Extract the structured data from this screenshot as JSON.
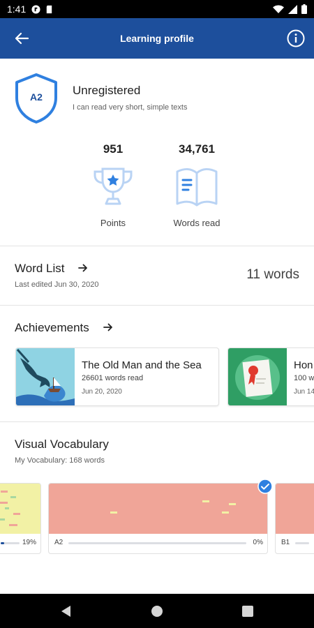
{
  "status_bar": {
    "time": "1:41"
  },
  "app_bar": {
    "title": "Learning profile"
  },
  "level": {
    "badge": "A2",
    "title": "Unregistered",
    "description": "I can read very short, simple texts"
  },
  "stats": [
    {
      "value": "951",
      "label": "Points",
      "icon": "trophy-icon"
    },
    {
      "value": "34,761",
      "label": "Words read",
      "icon": "book-icon"
    }
  ],
  "word_list": {
    "title": "Word List",
    "subtitle": "Last edited Jun 30, 2020",
    "count": "11 words"
  },
  "achievements": {
    "title": "Achievements",
    "cards": [
      {
        "title": "The Old Man and the Sea",
        "subtitle": "26601 words read",
        "date": "Jun 20, 2020",
        "thumb": "marlin-illustration"
      },
      {
        "title": "Hon",
        "subtitle": "100 w",
        "date": "Jun 14",
        "thumb": "certificate-illustration"
      }
    ]
  },
  "visual_vocabulary": {
    "title": "Visual Vocabulary",
    "subtitle": "My Vocabulary: 168 words",
    "cards": [
      {
        "level": "",
        "percent": "19%",
        "progress": 0.19,
        "color": "#f2f1a5"
      },
      {
        "level": "A2",
        "percent": "0%",
        "progress": 0.0,
        "color": "#f0a598",
        "selected": true
      },
      {
        "level": "B1",
        "percent": "",
        "progress": 0.0,
        "color": "#f0a598"
      }
    ]
  },
  "colors": {
    "brand": "#1d4f9c",
    "accent": "#2f80e0",
    "icon_light": "#b9d3f4"
  }
}
